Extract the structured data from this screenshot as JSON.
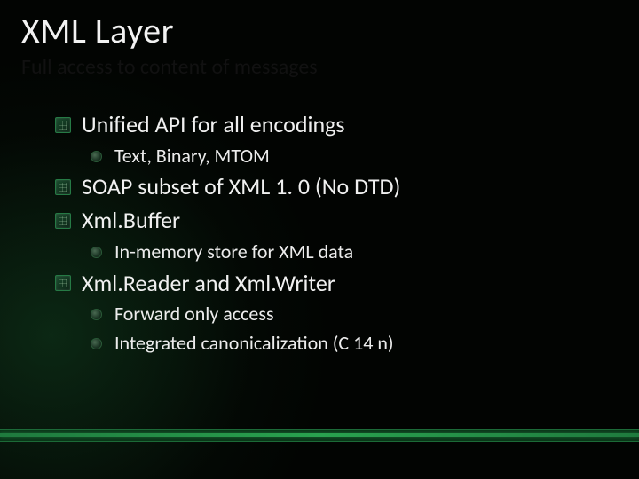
{
  "title": "XML Layer",
  "subtitle": "Full access to content of messages",
  "items": [
    {
      "text": "Unified API for all encodings",
      "children": [
        {
          "text": "Text, Binary, MTOM"
        }
      ]
    },
    {
      "text": "SOAP subset of XML 1. 0 (No DTD)",
      "children": []
    },
    {
      "text": "Xml.Buffer",
      "children": [
        {
          "text": "In-memory store for XML data"
        }
      ]
    },
    {
      "text": "Xml.Reader and  Xml.Writer",
      "children": [
        {
          "text": "Forward only access"
        },
        {
          "text": "Integrated canonicalization (C 14 n)"
        }
      ]
    }
  ]
}
